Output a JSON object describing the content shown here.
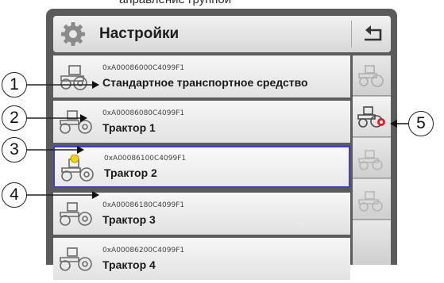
{
  "top_caption": "аправление группой",
  "header": {
    "title": "Настройки",
    "gear_icon": "gear-icon",
    "back_icon": "back-arrow-icon"
  },
  "rows": [
    {
      "id": "0xA00086000C4099F1",
      "name": "Стандартное транспортное средство",
      "selected": false
    },
    {
      "id": "0xA00086080C4099F1",
      "name": "Трактор 1",
      "selected": false
    },
    {
      "id": "0xA00086100C4099F1",
      "name": "Трактор 2",
      "selected": true,
      "active": true
    },
    {
      "id": "0xA00086180C4099F1",
      "name": "Трактор 3",
      "selected": false
    },
    {
      "id": "0xA00086200C4099F1",
      "name": "Трактор 4",
      "selected": false
    }
  ],
  "callouts": [
    "1",
    "2",
    "3",
    "4",
    "5"
  ],
  "colors": {
    "selection": "#3f3fc8",
    "active_dot": "#f2d21a",
    "frame": "#5b5b5b"
  }
}
